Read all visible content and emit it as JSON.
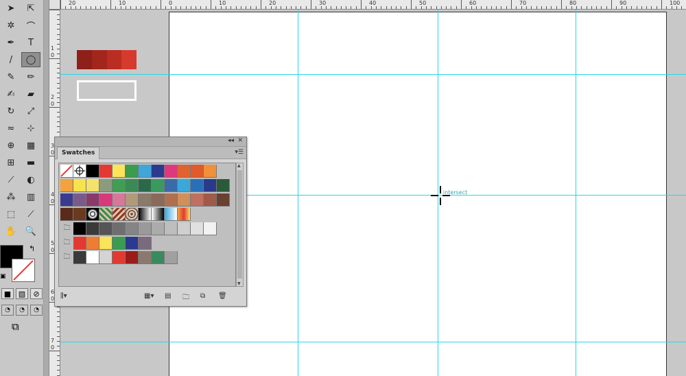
{
  "tools": [
    {
      "name": "selection-tool",
      "glyph": "➤"
    },
    {
      "name": "direct-selection-tool",
      "glyph": "⇱"
    },
    {
      "name": "magic-wand-tool",
      "glyph": "✲"
    },
    {
      "name": "lasso-tool",
      "glyph": "⌒"
    },
    {
      "name": "pen-tool",
      "glyph": "✒"
    },
    {
      "name": "type-tool",
      "glyph": "T"
    },
    {
      "name": "line-tool",
      "glyph": "/"
    },
    {
      "name": "ellipse-tool",
      "glyph": "◯"
    },
    {
      "name": "paintbrush-tool",
      "glyph": "✎"
    },
    {
      "name": "pencil-tool",
      "glyph": "✏"
    },
    {
      "name": "blob-brush-tool",
      "glyph": "✍"
    },
    {
      "name": "eraser-tool",
      "glyph": "▰"
    },
    {
      "name": "rotate-tool",
      "glyph": "↻"
    },
    {
      "name": "scale-tool",
      "glyph": "⤢"
    },
    {
      "name": "width-tool",
      "glyph": "≈"
    },
    {
      "name": "free-transform-tool",
      "glyph": "⊹"
    },
    {
      "name": "shape-builder-tool",
      "glyph": "⊕"
    },
    {
      "name": "perspective-grid-tool",
      "glyph": "▦"
    },
    {
      "name": "mesh-tool",
      "glyph": "⊞"
    },
    {
      "name": "gradient-tool",
      "glyph": "▬"
    },
    {
      "name": "eyedropper-tool",
      "glyph": "⟋"
    },
    {
      "name": "blend-tool",
      "glyph": "◐"
    },
    {
      "name": "symbol-sprayer-tool",
      "glyph": "⁂"
    },
    {
      "name": "column-graph-tool",
      "glyph": "▥"
    },
    {
      "name": "artboard-tool",
      "glyph": "⬚"
    },
    {
      "name": "slice-tool",
      "glyph": "⟋"
    },
    {
      "name": "hand-tool",
      "glyph": "✋"
    },
    {
      "name": "zoom-tool",
      "glyph": "🔍"
    }
  ],
  "ruler_top_labels": [
    "20",
    "10",
    "0",
    "10",
    "20",
    "30",
    "40",
    "50",
    "60",
    "70",
    "80",
    "90",
    "100"
  ],
  "ruler_left_labels": [
    "1",
    "0",
    "2",
    "0",
    "3",
    "0",
    "4",
    "0",
    "5",
    "0",
    "6",
    "0",
    "7",
    "0"
  ],
  "palette_colors": [
    "#8e1f19",
    "#a3261d",
    "#b92d22",
    "#d63a2c"
  ],
  "panel": {
    "title": "Swatches",
    "collapse_glyph": "◂◂",
    "close_glyph": "✕",
    "menu_glyph": "▾☰",
    "footer_icons": [
      "libraries-icon",
      "swatch-kinds-icon",
      "swatch-options-icon",
      "new-color-group-icon",
      "new-swatch-icon",
      "delete-swatch-icon"
    ]
  },
  "swatch_rows": [
    [
      "none",
      "registration",
      "#000000",
      "#e23a33",
      "#fbe35a",
      "#3a9c4e",
      "#3ea6da",
      "#2b3a8f",
      "#e0387e",
      "#e0632f",
      "#e05a2a",
      "#f0913a"
    ],
    [
      "#f3a33b",
      "#f6e34e",
      "#f4e36a",
      "#8e9a7e",
      "#3e9e52",
      "#3a8a55",
      "#2a6a4a",
      "#3a9a5e",
      "#3a6aa8",
      "#3aa8da",
      "#2a70b8",
      "#2a3a8a",
      "#2a5a3a"
    ],
    [
      "#3a3a8e",
      "#7a5a8a",
      "#8a3a6a",
      "#d63a7a",
      "#d6789a",
      "#b09a7a",
      "#8a7a6a",
      "#8a6a5a",
      "#b07050",
      "#d0905a",
      "#c07060",
      "#a05a4a",
      "#6a4030"
    ],
    [
      "#5a2a1a",
      "#6a3a20",
      "pattern1",
      "pattern2",
      "pattern3",
      "pattern4",
      "grad1",
      "grad2",
      "grad3",
      "grad4"
    ],
    [
      "folder",
      "#000000",
      "#3a3a3a",
      "#555555",
      "#6e6e6e",
      "#858585",
      "#9a9a9a",
      "#ababab",
      "#bdbdbd",
      "#cfcfcf",
      "#e0e0e0",
      "#f2f2f2"
    ],
    [
      "folder",
      "#e23a33",
      "#ef7d31",
      "#fbe35a",
      "#3a9c4e",
      "#2b3a8f",
      "#7a6a7e"
    ],
    [
      "folder",
      "#3a3a3a",
      "#ffffff",
      "#d4d4d4",
      "#e23a33",
      "#9a1d1a",
      "#8a7a6e",
      "#3a8a60",
      "#a0a0a0"
    ]
  ],
  "cursor_label": "intersect",
  "colors": {
    "guide": "#27d6e4",
    "fill": "#000000"
  }
}
